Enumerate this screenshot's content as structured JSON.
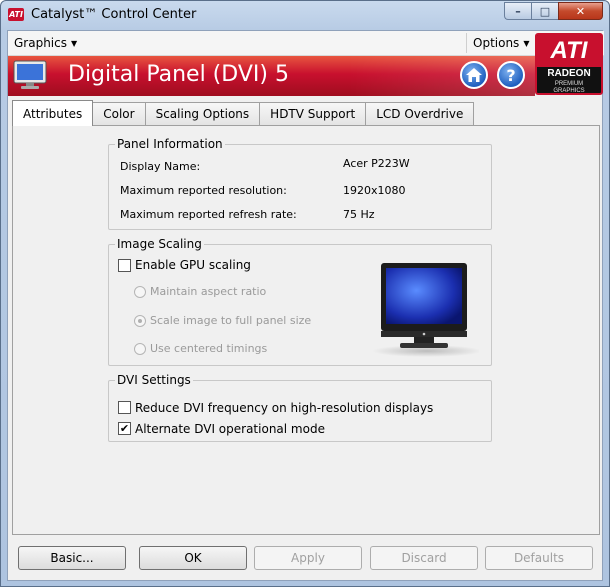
{
  "window": {
    "title": "Catalyst™ Control Center",
    "controls": {
      "minimize": "–",
      "maximize": "□",
      "close": "✕"
    }
  },
  "menubar": {
    "graphics": "Graphics",
    "options": "Options"
  },
  "logo": {
    "brand": "ATI",
    "line": "RADEON",
    "tag1": "PREMIUM",
    "tag2": "GRAPHICS"
  },
  "banner": {
    "title": "Digital Panel (DVI) 5",
    "accent": "#c8102e",
    "home_icon": "home-icon",
    "help_icon": "help-icon"
  },
  "tabs": [
    {
      "label": "Attributes",
      "active": true
    },
    {
      "label": "Color",
      "active": false
    },
    {
      "label": "Scaling Options",
      "active": false
    },
    {
      "label": "HDTV Support",
      "active": false
    },
    {
      "label": "LCD Overdrive",
      "active": false
    }
  ],
  "panel_info": {
    "title": "Panel Information",
    "rows": [
      {
        "label": "Display Name:",
        "value": "Acer P223W"
      },
      {
        "label": "Maximum reported resolution:",
        "value": "1920x1080"
      },
      {
        "label": "Maximum reported refresh rate:",
        "value": "75 Hz"
      }
    ]
  },
  "image_scaling": {
    "title": "Image Scaling",
    "enable_gpu": {
      "label": "Enable GPU scaling",
      "checked": false
    },
    "options": [
      {
        "label": "Maintain aspect ratio",
        "selected": false
      },
      {
        "label": "Scale image to full panel size",
        "selected": true
      },
      {
        "label": "Use centered timings",
        "selected": false
      }
    ]
  },
  "dvi_settings": {
    "title": "DVI Settings",
    "reduce": {
      "label": "Reduce DVI frequency on high-resolution displays",
      "checked": false
    },
    "alternate": {
      "label": "Alternate DVI operational mode",
      "checked": true
    }
  },
  "buttons": {
    "basic": "Basic...",
    "ok": "OK",
    "apply": "Apply",
    "discard": "Discard",
    "defaults": "Defaults"
  }
}
